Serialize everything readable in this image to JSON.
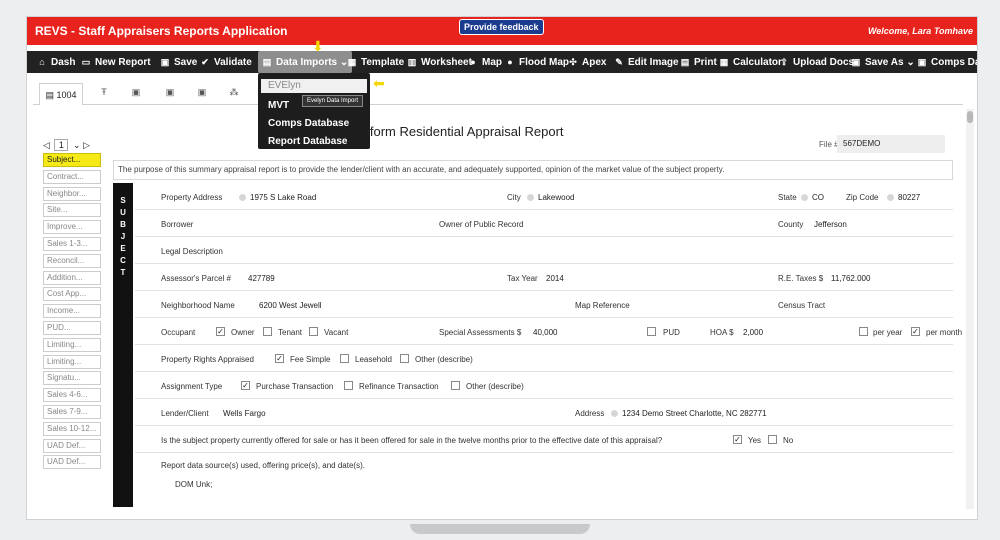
{
  "app": {
    "title": "REVS - Staff Appraisers Reports Application",
    "feedback": "Provide feedback",
    "welcome": "Welcome, Lara Tomhave"
  },
  "toolbar": {
    "dash": "Dash",
    "new_report": "New Report",
    "save": "Save",
    "validate": "Validate",
    "data_imports": "Data Imports",
    "template": "Template",
    "worksheet": "Worksheet",
    "map": "Map",
    "flood_map": "Flood Map",
    "apex": "Apex",
    "edit_image": "Edit Image",
    "print": "Print",
    "calculator": "Calculator",
    "upload_docs": "Upload Docs",
    "save_as": "Save As",
    "comps_data": "Comps Data"
  },
  "dropdown": {
    "evelyn": "EVElyn",
    "tooltip": "Evelyn Data Import",
    "mvt": "MVT",
    "comps_database": "Comps Database",
    "report_database": "Report Database"
  },
  "tabs": {
    "first": "1004"
  },
  "nav": {
    "page": "1"
  },
  "sidebar": [
    "Subject...",
    "Contract...",
    "Neighbor...",
    "Site...",
    "Improve...",
    "Sales 1-3...",
    "Reconcil...",
    "Addition...",
    "Cost App...",
    "Income...",
    "PUD...",
    "Limiting...",
    "Limiting...",
    "Signatu...",
    "Sales 4-6...",
    "Sales 7-9...",
    "Sales 10-12...",
    "UAD Def...",
    "UAD Def..."
  ],
  "report": {
    "title": "iform Residential Appraisal Report",
    "file_label": "File #",
    "file_value": "567DEMO",
    "purpose": "The purpose of this summary appraisal report is to provide the lender/client with an accurate, and adequately supported, opinion of the market value of the subject property.",
    "subject_label": "SUBJECT"
  },
  "fields": {
    "property_address_label": "Property Address",
    "property_address": "1975 S Lake Road",
    "city_label": "City",
    "city": "Lakewood",
    "state_label": "State",
    "state": "CO",
    "zip_label": "Zip Code",
    "zip": "80227",
    "borrower_label": "Borrower",
    "owner_label": "Owner of Public Record",
    "county_label": "County",
    "county": "Jefferson",
    "legal_label": "Legal Description",
    "parcel_label": "Assessor's Parcel #",
    "parcel": "427789",
    "tax_year_label": "Tax Year",
    "tax_year": "2014",
    "re_taxes_label": "R.E. Taxes $",
    "re_taxes": "11,762.000",
    "neighborhood_label": "Neighborhood Name",
    "neighborhood": "6200 West Jewell",
    "map_ref_label": "Map Reference",
    "census_label": "Census Tract",
    "occupant_label": "Occupant",
    "owner_opt": "Owner",
    "tenant_opt": "Tenant",
    "vacant_opt": "Vacant",
    "special_label": "Special Assessments $",
    "special": "40,000",
    "pud_label": "PUD",
    "hoa_label": "HOA $",
    "hoa": "2,000",
    "per_year": "per year",
    "per_month": "per month",
    "rights_label": "Property Rights Appraised",
    "fee_simple": "Fee Simple",
    "leasehold": "Leasehold",
    "other_describe": "Other (describe)",
    "assignment_label": "Assignment Type",
    "purchase": "Purchase Transaction",
    "refinance": "Refinance Transaction",
    "other_describe2": "Other (describe)",
    "lender_label": "Lender/Client",
    "lender": "Wells Fargo",
    "address_label": "Address",
    "address": "1234 Demo Street Charlotte, NC 282771",
    "offered_question": "Is the subject property currently offered for sale or has it been offered for sale in the twelve months prior to the effective date of this appraisal?",
    "yes": "Yes",
    "no": "No",
    "data_source_label": "Report data source(s) used, offering price(s), and date(s).",
    "dom_label": "DOM Unk;"
  }
}
